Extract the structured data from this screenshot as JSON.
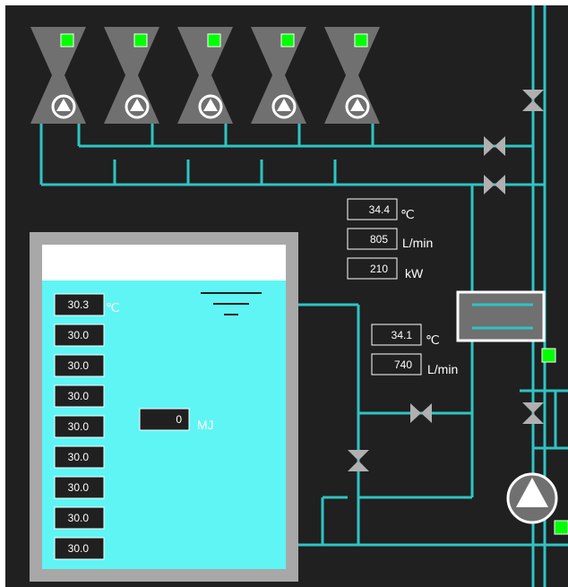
{
  "colors": {
    "background": "#202020",
    "pipe": "#2ec4c4",
    "water": "#5ff5f5",
    "tank_wall": "#a8a8a8",
    "tank_empty": "#ffffff",
    "unit_body": "#707070",
    "indicator_on": "#00ff00"
  },
  "units": [
    {
      "id": "unit-1",
      "status": "on",
      "icon": "pump-icon"
    },
    {
      "id": "unit-2",
      "status": "on",
      "icon": "pump-icon"
    },
    {
      "id": "unit-3",
      "status": "on",
      "icon": "pump-icon"
    },
    {
      "id": "unit-4",
      "status": "on",
      "icon": "pump-icon"
    },
    {
      "id": "unit-5",
      "status": "on",
      "icon": "pump-icon"
    }
  ],
  "supply_readings": {
    "temperature": {
      "value": "34.4",
      "unit": "℃"
    },
    "flow": {
      "value": "805",
      "unit": "L/min"
    },
    "power": {
      "value": "210",
      "unit": "kW"
    }
  },
  "return_readings": {
    "temperature": {
      "value": "34.1",
      "unit": "℃"
    },
    "flow": {
      "value": "740",
      "unit": "L/min"
    }
  },
  "tank": {
    "top_temp_unit": "℃",
    "temperatures": [
      "30.3",
      "30.0",
      "30.0",
      "30.0",
      "30.0",
      "30.0",
      "30.0",
      "30.0",
      "30.0"
    ],
    "heat": {
      "value": "0",
      "unit": "MJ"
    },
    "water_level_fraction": 0.88
  },
  "indicators": {
    "heat_exchanger_status": "on",
    "pump_status": "on"
  },
  "icons": [
    "valve-icon",
    "pump-icon",
    "heat-exchanger-icon",
    "water-level-icon",
    "status-light-icon"
  ]
}
